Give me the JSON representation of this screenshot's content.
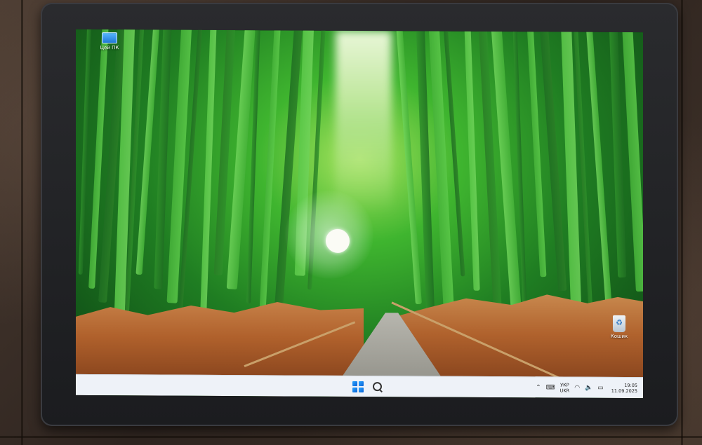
{
  "desktop": {
    "icons": [
      {
        "label": "Цей ПК",
        "icon": "this-pc-icon"
      },
      {
        "label": "Кошик",
        "icon": "recycle-bin-icon"
      }
    ]
  },
  "taskbar": {
    "start_icon": "windows-start-icon",
    "search_icon": "search-icon",
    "tray": {
      "chevron_glyph": "⌃",
      "keyboard_glyph": "⌨",
      "lang_top": "УКР",
      "lang_bottom": "UKR",
      "wifi_glyph": "◠",
      "volume_glyph": "🔈",
      "battery_glyph": "▭",
      "time": "19:05",
      "date": "11.09.2025"
    }
  },
  "colors": {
    "taskbar_bg": "#eef2f8",
    "start_blue": "#0a62d6",
    "bamboo_green": "#3fb52f"
  }
}
